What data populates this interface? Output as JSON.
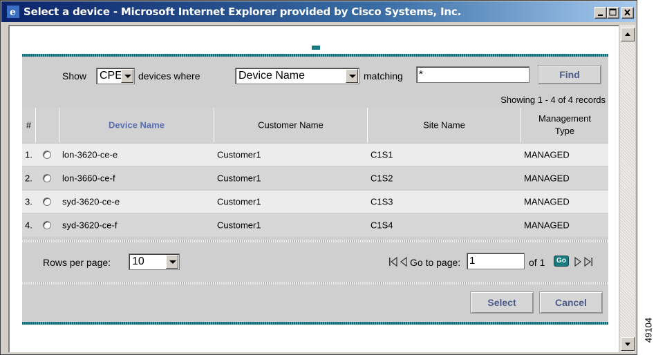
{
  "window": {
    "title": "Select a device - Microsoft Internet Explorer provided by Cisco Systems, Inc."
  },
  "filter": {
    "show_label": "Show",
    "type_value": "CPE",
    "where_label": "devices where",
    "field_value": "Device Name",
    "matching_label": "matching",
    "match_value": "*",
    "find_label": "Find"
  },
  "status": {
    "showing": "Showing 1 - 4 of 4 records"
  },
  "table": {
    "headers": {
      "num": "#",
      "device": "Device Name",
      "customer": "Customer Name",
      "site": "Site Name",
      "mgmt": "Management Type"
    },
    "rows": [
      {
        "num": "1.",
        "device": "lon-3620-ce-e",
        "customer": "Customer1",
        "site": "C1S1",
        "mgmt": "MANAGED"
      },
      {
        "num": "2.",
        "device": "lon-3660-ce-f",
        "customer": "Customer1",
        "site": "C1S2",
        "mgmt": "MANAGED"
      },
      {
        "num": "3.",
        "device": "syd-3620-ce-e",
        "customer": "Customer1",
        "site": "C1S3",
        "mgmt": "MANAGED"
      },
      {
        "num": "4.",
        "device": "syd-3620-ce-f",
        "customer": "Customer1",
        "site": "C1S4",
        "mgmt": "MANAGED"
      }
    ]
  },
  "pagination": {
    "rows_label": "Rows per page:",
    "rows_value": "10",
    "goto_label": "Go to page:",
    "page_value": "1",
    "of_label": "of 1",
    "go_label": "Go"
  },
  "actions": {
    "select_label": "Select",
    "cancel_label": "Cancel"
  },
  "figure_id": "49104",
  "colors": {
    "title_start": "#0a246a",
    "title_end": "#a6caf0",
    "accent_teal": "#0f6b75",
    "header_link": "#5a6fb0",
    "button_text": "#4a5b8a"
  }
}
